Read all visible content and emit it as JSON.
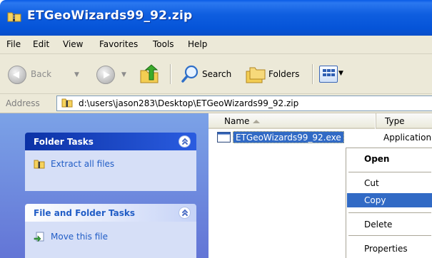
{
  "window": {
    "title": "ETGeoWizards99_92.zip"
  },
  "menubar": {
    "items": [
      "File",
      "Edit",
      "View",
      "Favorites",
      "Tools",
      "Help"
    ]
  },
  "toolbar": {
    "back_label": "Back",
    "search_label": "Search",
    "folders_label": "Folders"
  },
  "address": {
    "label": "Address",
    "value": "d:\\users\\jason283\\Desktop\\ETGeoWizards99_92.zip"
  },
  "taskpane": {
    "folder_tasks": {
      "title": "Folder Tasks",
      "links": [
        "Extract all files"
      ]
    },
    "file_folder_tasks": {
      "title": "File and Folder Tasks",
      "links": [
        "Move this file"
      ]
    }
  },
  "filelist": {
    "columns": [
      "Name",
      "Type"
    ],
    "rows": [
      {
        "name": "ETGeoWizards99_92.exe",
        "type": "Application",
        "selected": true
      }
    ]
  },
  "context_menu": {
    "items": [
      "Open",
      "Cut",
      "Copy",
      "Delete",
      "Properties"
    ],
    "default_item": "Open",
    "highlighted_item": "Copy"
  },
  "colors": {
    "title_bar": "#0554d8",
    "selection": "#316ac5",
    "task_pane": "#7ba2e7",
    "chrome": "#ece9d8"
  },
  "icons": {
    "title": "zip-folder-icon",
    "back": "back-arrow-icon",
    "forward": "forward-arrow-icon",
    "up": "folder-up-icon",
    "search": "search-icon",
    "folders": "folders-icon",
    "views": "views-icon",
    "address": "zip-folder-icon",
    "extract": "extract-icon",
    "move": "move-file-icon",
    "file": "exe-file-icon"
  }
}
